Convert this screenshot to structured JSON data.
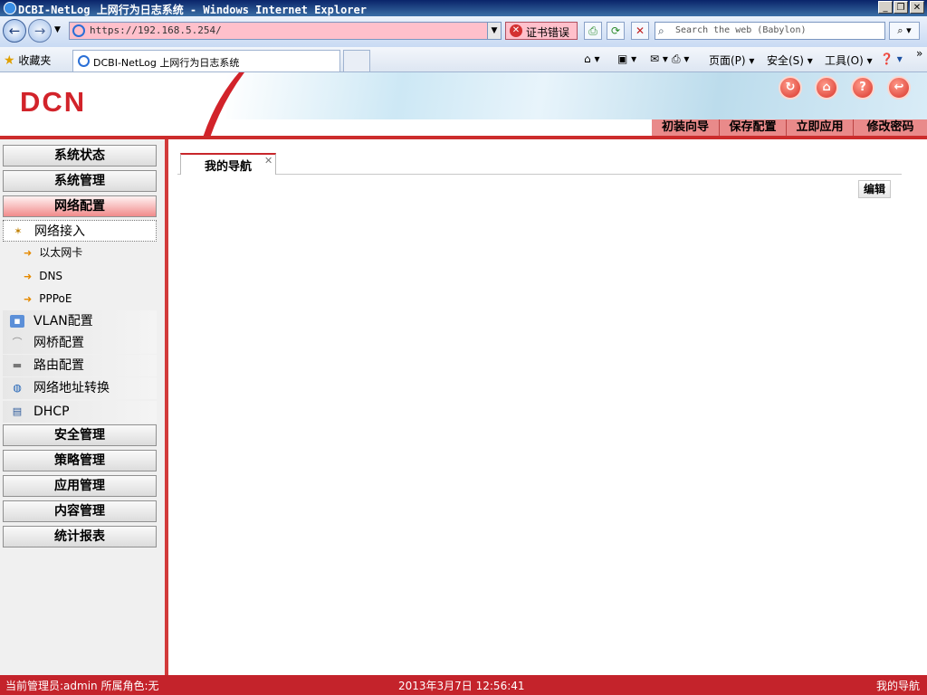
{
  "window": {
    "title": "DCBI-NetLog 上网行为日志系统 - Windows Internet Explorer"
  },
  "browser": {
    "address": "https://192.168.5.254/",
    "cert_error": "证书错误",
    "search_placeholder": "Search the web (Babylon)",
    "favorites_label": "收藏夹",
    "tab_title": "DCBI-NetLog 上网行为日志系统",
    "commands": {
      "page": "页面(P)",
      "safety": "安全(S)",
      "tools": "工具(O)"
    }
  },
  "header": {
    "logo": "DCN",
    "nav": [
      "初装向导",
      "保存配置",
      "立即应用",
      "修改密码"
    ]
  },
  "sidebar": {
    "sections_top": [
      "系统状态",
      "系统管理",
      "网络配置"
    ],
    "network_items": [
      {
        "label": "网络接入",
        "icon": "network-access-icon"
      },
      {
        "label": "VLAN配置",
        "icon": "vlan-icon"
      },
      {
        "label": "网桥配置",
        "icon": "bridge-icon"
      },
      {
        "label": "路由配置",
        "icon": "router-icon"
      },
      {
        "label": "网络地址转换",
        "icon": "nat-icon"
      },
      {
        "label": "DHCP",
        "icon": "dhcp-icon"
      }
    ],
    "sub_items": [
      "以太网卡",
      "DNS",
      "PPPoE"
    ],
    "sections_bottom": [
      "安全管理",
      "策略管理",
      "应用管理",
      "内容管理",
      "统计报表"
    ]
  },
  "main": {
    "tab_label": "我的导航",
    "edit_label": "编辑"
  },
  "status": {
    "admin": "当前管理员:admin  所属角色:无",
    "datetime": "2013年3月7日 12:56:41",
    "location": "我的导航"
  },
  "colors": {
    "brand_red": "#c4232b",
    "active_section": "#f18b8b",
    "cert_error_bg": "#ffc0cb"
  }
}
